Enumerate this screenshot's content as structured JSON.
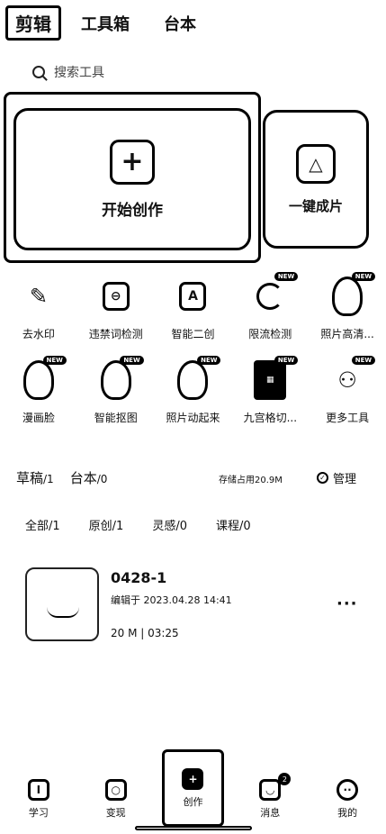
{
  "top_tabs": [
    "剪辑",
    "工具箱",
    "台本"
  ],
  "search": {
    "placeholder": "搜索工具"
  },
  "create_card": {
    "icon": "plus-icon",
    "label": "开始创作"
  },
  "clip_card": {
    "icon": "one-click-clip-icon",
    "label": "一键成片"
  },
  "tools": [
    {
      "label": "去水印",
      "icon": "watermark-remove-icon",
      "badge": ""
    },
    {
      "label": "违禁词检测",
      "icon": "word-check-icon",
      "badge": ""
    },
    {
      "label": "智能二创",
      "icon": "ai-recreate-icon",
      "badge": ""
    },
    {
      "label": "限流检测",
      "icon": "limit-check-icon",
      "badge": "NEW"
    },
    {
      "label": "照片高清...",
      "icon": "photo-hd-icon",
      "badge": "NEW"
    },
    {
      "label": "漫画脸",
      "icon": "comic-face-icon",
      "badge": "NEW"
    },
    {
      "label": "智能抠图",
      "icon": "smart-cutout-icon",
      "badge": "NEW"
    },
    {
      "label": "照片动起来",
      "icon": "photo-animate-icon",
      "badge": "NEW"
    },
    {
      "label": "九宫格切...",
      "icon": "grid-cut-icon",
      "badge": "NEW"
    },
    {
      "label": "更多工具",
      "icon": "more-tools-icon",
      "badge": "NEW"
    }
  ],
  "drafts": {
    "tab_drafts": "草稿",
    "tab_drafts_count": "/1",
    "tab_scripts": "台本",
    "tab_scripts_count": "/0",
    "storage": "存储占用20.9M",
    "manage": "管理"
  },
  "filters": [
    "全部/1",
    "原创/1",
    "灵感/0",
    "课程/0"
  ],
  "draft_item": {
    "title": "0428-1",
    "edited": "编辑于 2023.04.28 14:41",
    "meta": "20 M | 03:25"
  },
  "bottom_nav": [
    {
      "label": "学习",
      "icon": "learn-icon"
    },
    {
      "label": "变现",
      "icon": "monetize-icon"
    },
    {
      "label": "创作",
      "icon": "create-icon",
      "active": true
    },
    {
      "label": "消息",
      "icon": "message-icon",
      "badge": "2"
    },
    {
      "label": "我的",
      "icon": "profile-icon"
    }
  ]
}
